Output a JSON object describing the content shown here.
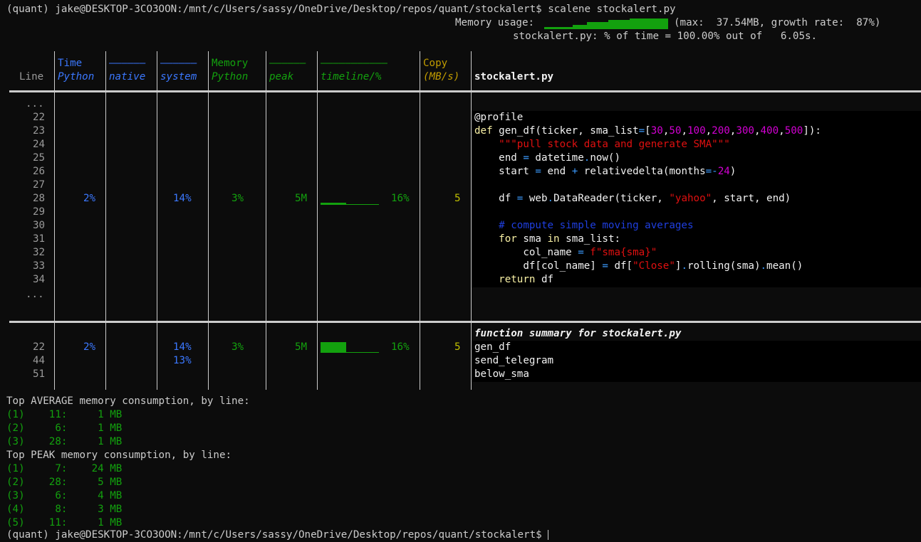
{
  "terminal": {
    "prompt": "(quant) jake@DESKTOP-3CO3OON:/mnt/c/Users/sassy/OneDrive/Desktop/repos/quant/stockalert$",
    "command": "scalene stockalert.py",
    "memory_usage_label": "Memory usage:",
    "memory_usage_stats": "(max:  37.54MB, growth rate:  87%)",
    "time_summary": "stockalert.py: % of time = 100.00% out of   6.05s.",
    "final_prompt": "(quant) jake@DESKTOP-3CO3OON:/mnt/c/Users/sassy/OneDrive/Desktop/repos/quant/stockalert$"
  },
  "table": {
    "headers": {
      "line": "Line",
      "time_top": "Time",
      "time_python": "Python",
      "native_top": "––––––",
      "native": "native",
      "system_top": "––––––",
      "system": "system",
      "memory_top": "Memory",
      "memory_python": "Python",
      "peak_top": "––––––",
      "peak": "peak",
      "timeline_top": "–––––––––––",
      "timeline": "timeline/%",
      "copy_top": "Copy",
      "copy": "(MB/s)",
      "file": "stockalert.py"
    },
    "line_numbers": [
      "...",
      "22",
      "23",
      "24",
      "25",
      "26",
      "27",
      "28",
      "29",
      "30",
      "31",
      "32",
      "33",
      "34",
      "..."
    ],
    "line28": {
      "time_python": "2%",
      "system": "14%",
      "memory_python": "3%",
      "peak": "5M",
      "timeline_pct": "16%",
      "copy": "5"
    },
    "code": {
      "l22": "@profile",
      "l23_def": "def",
      "l23_a": " gen_df(ticker, sma_list",
      "l23_eq": "=",
      "l23_b": "[",
      "l23_n1": "30",
      "l23_n2": "50",
      "l23_n3": "100",
      "l23_n4": "200",
      "l23_n5": "300",
      "l23_n6": "400",
      "l23_n7": "500",
      "l23_c": "]):",
      "l24": "    \"\"\"pull stock data and generate SMA\"\"\"",
      "l25_a": "    end ",
      "l25_eq": "=",
      "l25_b": " datetime",
      "l25_dot": ".",
      "l25_c": "now()",
      "l26_a": "    start ",
      "l26_eq": "=",
      "l26_b": " end ",
      "l26_plus": "+",
      "l26_c": " relativedelta(months",
      "l26_eq2": "=-",
      "l26_n": "24",
      "l26_d": ")",
      "l28_a": "    df ",
      "l28_eq": "=",
      "l28_b": " web",
      "l28_dot": ".",
      "l28_c": "DataReader(ticker, ",
      "l28_str": "\"yahoo\"",
      "l28_d": ", start, end)",
      "l30": "    # compute simple moving averages",
      "l31_for": "    for",
      "l31_a": " sma ",
      "l31_in": "in",
      "l31_b": " sma_list:",
      "l32_a": "        col_name ",
      "l32_eq": "=",
      "l32_str1": " f\"sma",
      "l32_br1": "{",
      "l32_mid": "sma",
      "l32_br2": "}",
      "l32_str2": "\"",
      "l33_a": "        df[col_name] ",
      "l33_eq": "=",
      "l33_b": " df[",
      "l33_str": "\"Close\"",
      "l33_c": "]",
      "l33_dot": ".",
      "l33_d": "rolling(sma)",
      "l33_dot2": ".",
      "l33_e": "mean()",
      "l34_ret": "    return",
      "l34_a": " df"
    },
    "summary": {
      "title": "function summary for stockalert.py",
      "rows": [
        {
          "line": "22",
          "time_python": "2%",
          "system": "14%",
          "memory_python": "3%",
          "peak": "5M",
          "timeline_pct": "16%",
          "copy": "5",
          "func": "gen_df"
        },
        {
          "line": "44",
          "time_python": "",
          "system": "13%",
          "memory_python": "",
          "peak": "",
          "timeline_pct": "",
          "copy": "",
          "func": "send_telegram"
        },
        {
          "line": "51",
          "time_python": "",
          "system": "",
          "memory_python": "",
          "peak": "",
          "timeline_pct": "",
          "copy": "",
          "func": "below_sma"
        }
      ]
    }
  },
  "top_average": {
    "title": "Top AVERAGE memory consumption, by line:",
    "rows": [
      "(1)    11:     1 MB",
      "(2)     6:     1 MB",
      "(3)    28:     1 MB"
    ]
  },
  "top_peak": {
    "title": "Top PEAK memory consumption, by line:",
    "rows": [
      "(1)     7:    24 MB",
      "(2)    28:     5 MB",
      "(3)     6:     4 MB",
      "(4)     8:     3 MB",
      "(5)    11:     1 MB"
    ]
  },
  "colors": {
    "background": "#0c0c0c",
    "code_background": "#000000",
    "blue": "#3b78ff",
    "green": "#13a10e",
    "olive": "#c19c00"
  }
}
